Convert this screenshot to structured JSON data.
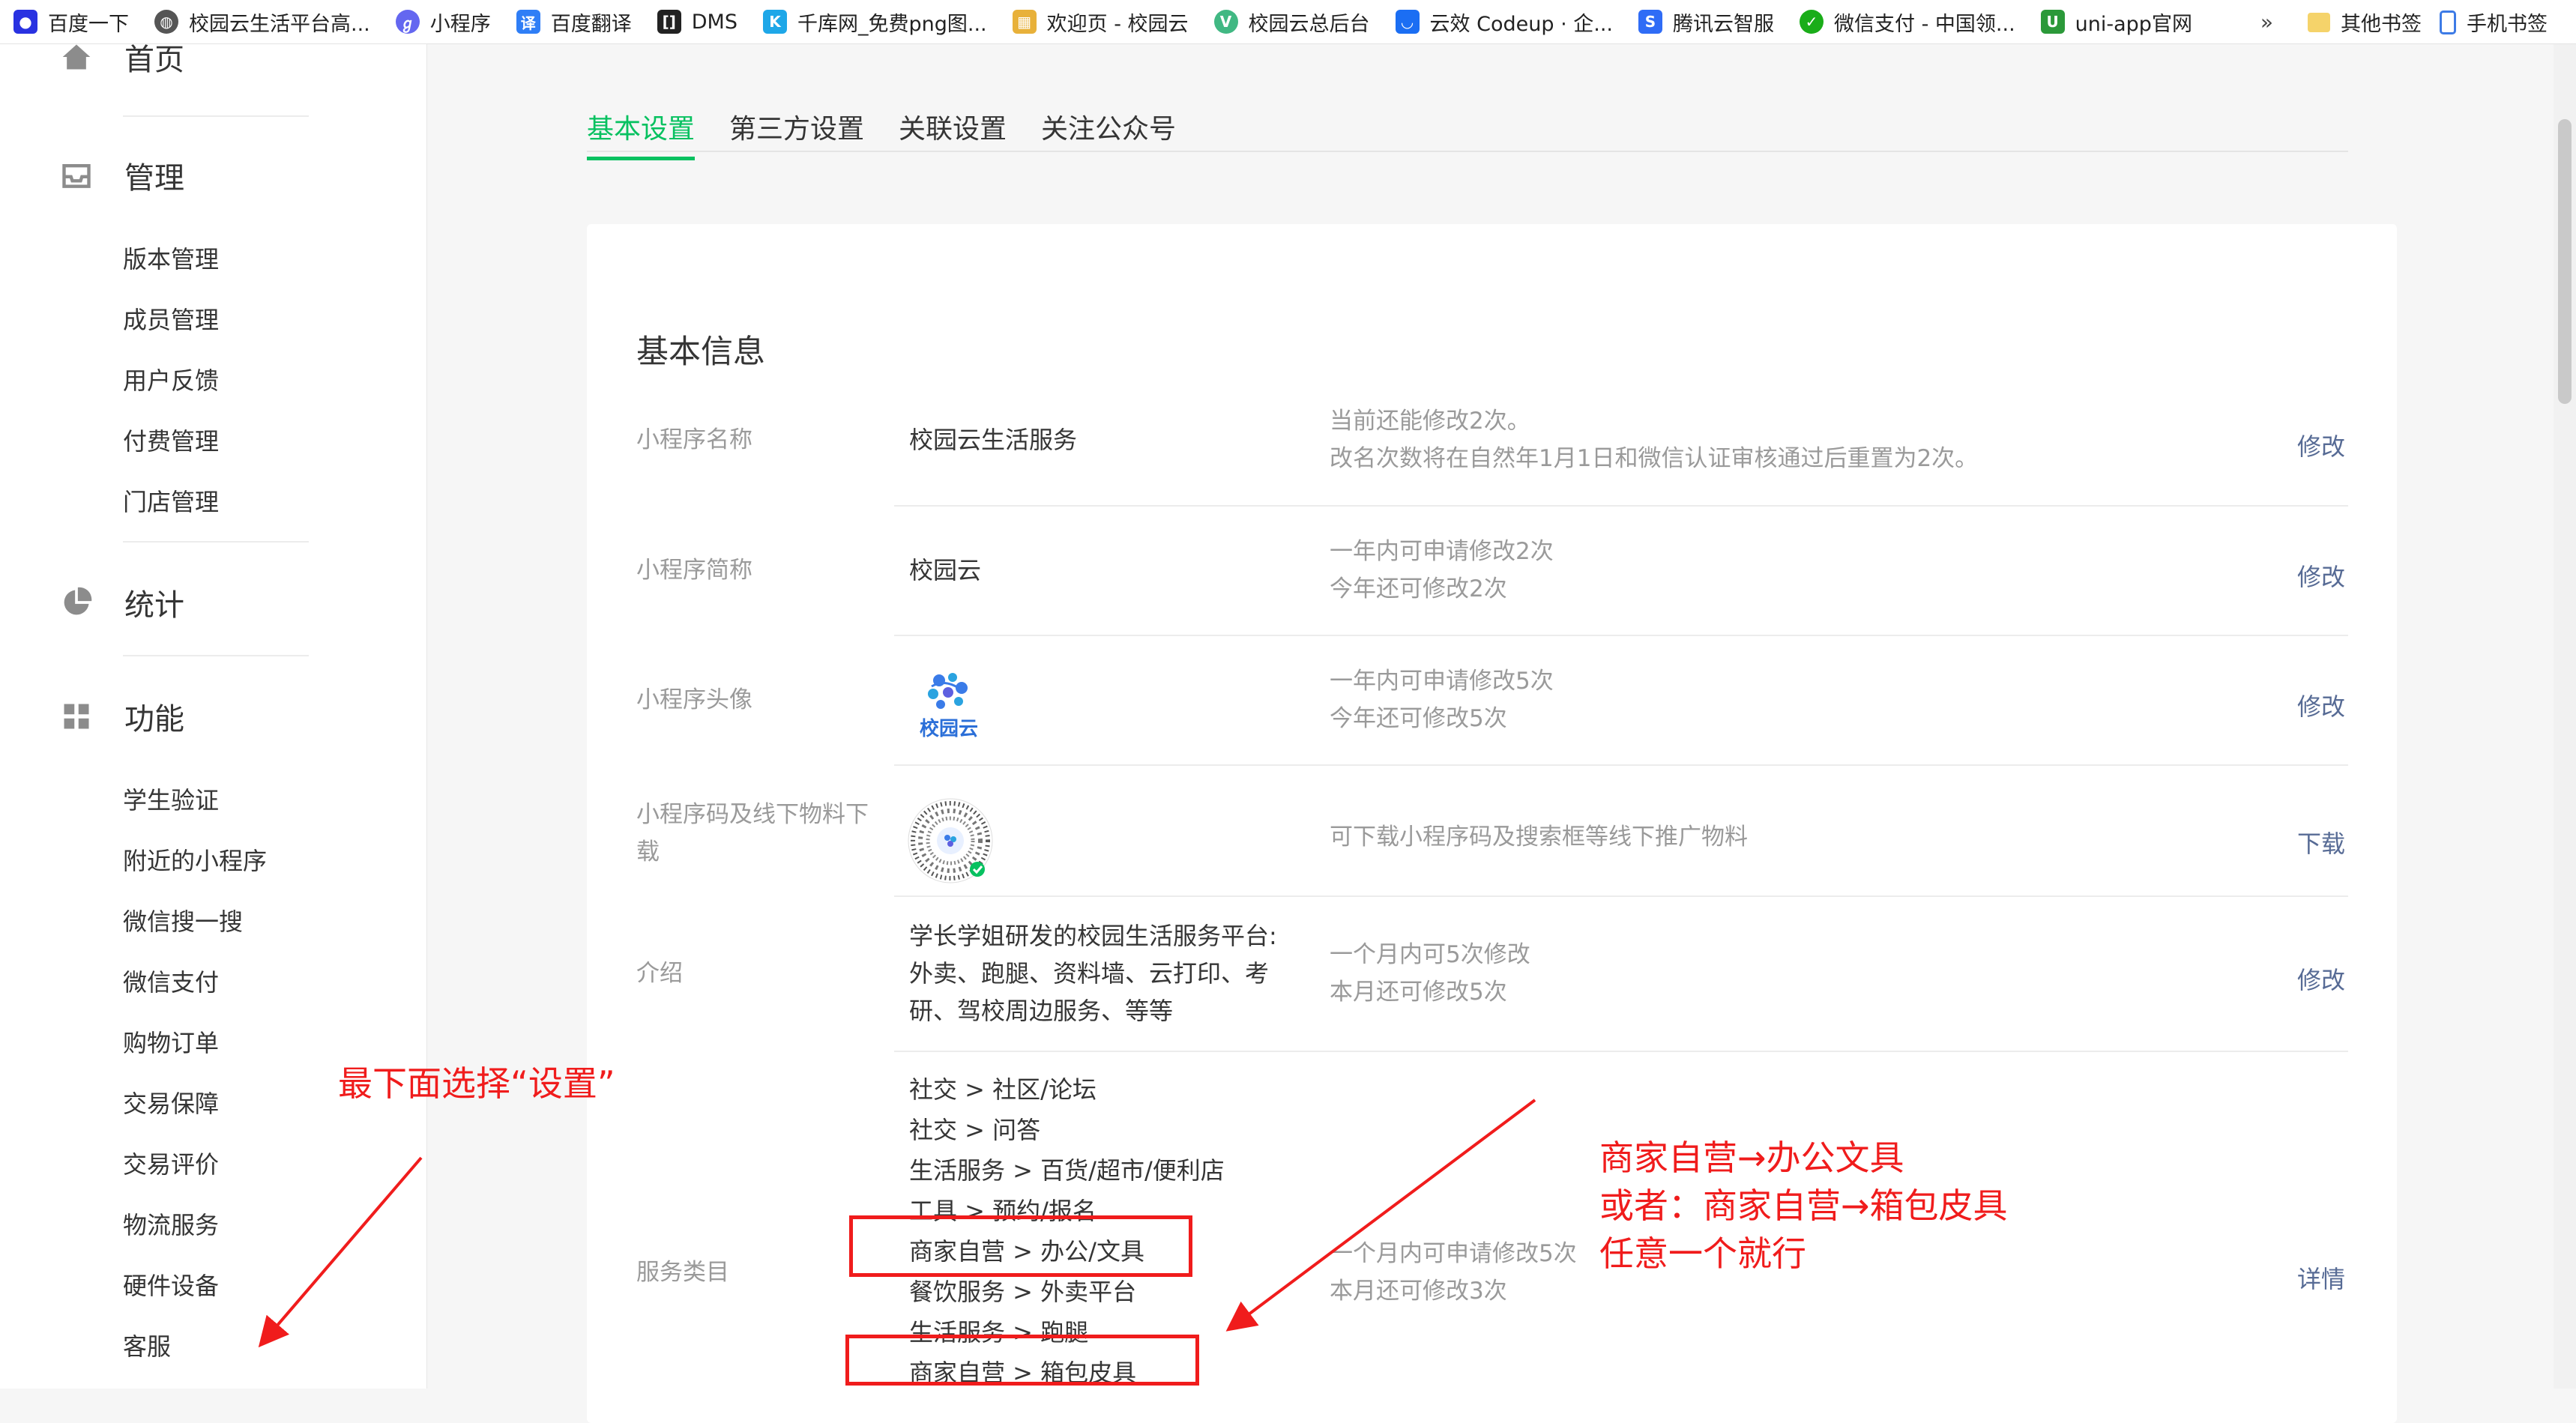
{
  "bookmarks": {
    "items": [
      {
        "label": "百度一下",
        "icon": "baidu-paw-icon",
        "color": "#2932e1"
      },
      {
        "label": "校园云生活平台高...",
        "icon": "globe-icon",
        "color": "#555555"
      },
      {
        "label": "小程序",
        "icon": "mini-program-icon",
        "color": "#6467f0"
      },
      {
        "label": "百度翻译",
        "icon": "translate-icon",
        "color": "#2f7ef6"
      },
      {
        "label": "DMS",
        "icon": "dms-icon",
        "color": "#222222"
      },
      {
        "label": "千库网_免费png图...",
        "icon": "qianku-icon",
        "color": "#1ea7e8"
      },
      {
        "label": "欢迎页 - 校园云",
        "icon": "page-icon",
        "color": "#e8b13a"
      },
      {
        "label": "校园云总后台",
        "icon": "vue-icon",
        "color": "#41b883"
      },
      {
        "label": "云效 Codeup · 企...",
        "icon": "codeup-icon",
        "color": "#1b6ef3"
      },
      {
        "label": "腾讯云智服",
        "icon": "tencent-cloud-icon",
        "color": "#2f6cf6"
      },
      {
        "label": "微信支付 - 中国领...",
        "icon": "wechat-pay-icon",
        "color": "#1aad19"
      },
      {
        "label": "uni-app官网",
        "icon": "uniapp-icon",
        "color": "#2b9939"
      }
    ],
    "more": "»",
    "right": [
      {
        "label": "其他书签",
        "icon": "folder-icon"
      },
      {
        "label": "手机书签",
        "icon": "phone-icon"
      }
    ]
  },
  "sidebar": {
    "groups": [
      {
        "title": "首页",
        "icon": "home-icon",
        "items": []
      },
      {
        "title": "管理",
        "icon": "inbox-icon",
        "items": [
          "版本管理",
          "成员管理",
          "用户反馈",
          "付费管理",
          "门店管理"
        ]
      },
      {
        "title": "统计",
        "icon": "pie-chart-icon",
        "items": []
      },
      {
        "title": "功能",
        "icon": "grid-icon",
        "items": [
          "学生验证",
          "附近的小程序",
          "微信搜一搜",
          "微信支付",
          "购物订单",
          "交易保障",
          "交易评价",
          "物流服务",
          "硬件设备",
          "客服"
        ]
      }
    ]
  },
  "main": {
    "tabs": [
      "基本设置",
      "第三方设置",
      "关联设置",
      "关注公众号"
    ],
    "active_tab": 0,
    "card_title": "基本信息",
    "rows": {
      "name": {
        "label": "小程序名称",
        "value": "校园云生活服务",
        "tip1": "当前还能修改2次。",
        "tip2": "改名次数将在自然年1月1日和微信认证审核通过后重置为2次。",
        "action": "修改"
      },
      "short": {
        "label": "小程序简称",
        "value": "校园云",
        "tip1": "一年内可申请修改2次",
        "tip2": "今年还可修改2次",
        "action": "修改"
      },
      "avatar": {
        "label": "小程序头像",
        "logo_text": "校园云",
        "tip1": "一年内可申请修改5次",
        "tip2": "今年还可修改5次",
        "action": "修改"
      },
      "qrcode": {
        "label": "小程序码及线下物料下载",
        "tip1": "可下载小程序码及搜索框等线下推广物料",
        "action": "下载"
      },
      "intro": {
        "label": "介绍",
        "value_lines": [
          "学长学姐研发的校园生活服务平台:",
          "外卖、跑腿、资料墙、云打印、考",
          "研、驾校周边服务、等等"
        ],
        "tip1": "一个月内可5次修改",
        "tip2": "本月还可修改5次",
        "action": "修改"
      },
      "category": {
        "label": "服务类目",
        "value_lines": [
          "社交 > 社区/论坛",
          "社交 > 问答",
          "生活服务 > 百货/超市/便利店",
          "工具 > 预约/报名",
          "商家自营 > 办公/文具",
          "餐饮服务 > 外卖平台",
          "生活服务 > 跑腿",
          "商家自营 > 箱包皮具"
        ],
        "tip1": "一个月内可申请修改5次",
        "tip2": "本月还可修改3次",
        "action": "详情"
      }
    }
  },
  "annotations": {
    "left_note": "最下面选择“设置”",
    "right_note_lines": [
      "商家自营→办公文具",
      "或者：商家自营→箱包皮具",
      "任意一个就行"
    ],
    "color": "#f01c1c"
  },
  "colors": {
    "accent_green": "#07c160",
    "link_blue": "#576b95",
    "muted": "#9a9a9a"
  }
}
